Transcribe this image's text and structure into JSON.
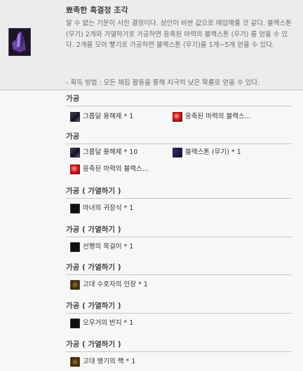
{
  "item": {
    "title": "뾰족한 흑결정 조각",
    "desc": "알 수 없는 기운이 서린 결정이다. 상인이 비싼 값으로 매입해줄 것 같다. 블랙스톤 (무기) 2개와 가열하기로 가공하면 응축된 마력의 블랙스톤 (무기) 를 얻을 수 있다. 2개를 모아 빻기로 가공하면 블랙스톤 (무기)를 1개~5개 얻을 수 있다.",
    "acquisition": "- 획득 방법 : 모든 채집 활동을 통해 지극히 낮은 확률로 얻을 수 있다.",
    "icon": "black-crystal-fragment-icon"
  },
  "recipes": [
    {
      "title": "가공",
      "materials": [
        {
          "label": "그름달 용해제 * 1",
          "icon": "dark-flask-icon"
        },
        {
          "label": "응축된 마력의 블랙스...",
          "icon": "red-stone-icon"
        }
      ]
    },
    {
      "title": "가공",
      "materials": [
        {
          "label": "그름달 용해제 * 10",
          "icon": "dark-flask-icon"
        },
        {
          "label": "블랙스톤 (무기) * 1",
          "icon": "black-stone-icon"
        },
        {
          "label": "응축된 마력의 블랙스...",
          "icon": "red-stone-icon"
        }
      ]
    },
    {
      "title": "가공 ( 가열하기 )",
      "materials": [
        {
          "label": "마녀의 귀장식 * 1",
          "icon": "earring-icon"
        }
      ]
    },
    {
      "title": "가공 ( 가열하기 )",
      "materials": [
        {
          "label": "선행의 목걸이 * 1",
          "icon": "necklace-icon"
        }
      ]
    },
    {
      "title": "가공 ( 가열하기 )",
      "materials": [
        {
          "label": "고대 수호자의 인장 * 1",
          "icon": "seal-icon"
        }
      ]
    },
    {
      "title": "가공 ( 가열하기 )",
      "materials": [
        {
          "label": "오우거의 반지 * 1",
          "icon": "ring-icon"
        }
      ]
    },
    {
      "title": "가공 ( 가열하기 )",
      "materials": [
        {
          "label": "고대 병기의 핵 * 1",
          "icon": "ancient-core-icon"
        }
      ]
    }
  ]
}
